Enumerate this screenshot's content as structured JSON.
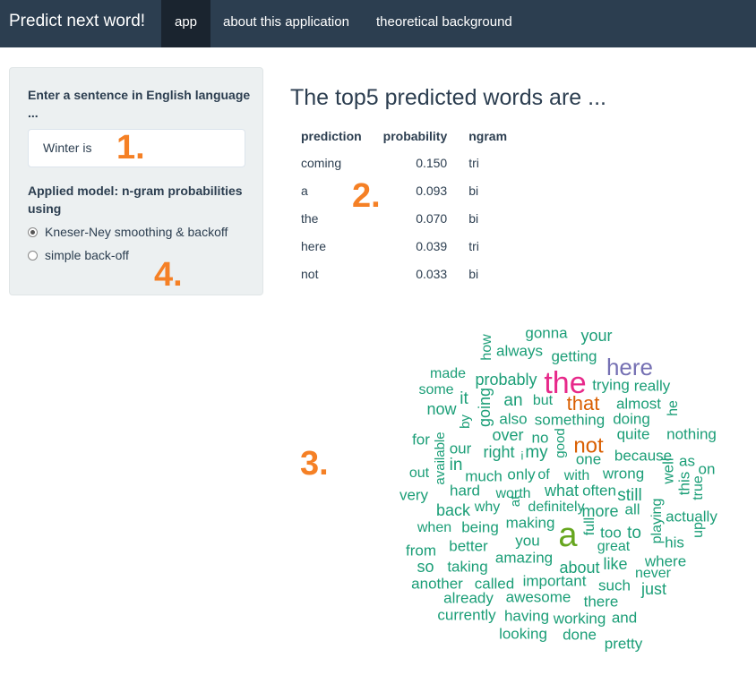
{
  "navbar": {
    "brand": "Predict next word!",
    "tabs": [
      "app",
      "about this application",
      "theoretical background"
    ]
  },
  "sidebar": {
    "input_label": "Enter a sentence in English language ...",
    "input_value": "Winter is",
    "model_label": "Applied model: n-gram probabilities using",
    "options": [
      {
        "label": "Kneser-Ney smoothing & backoff",
        "checked": true
      },
      {
        "label": "simple back-off",
        "checked": false
      }
    ]
  },
  "main": {
    "title": "The top5 predicted words are ...",
    "columns": [
      "prediction",
      "probability",
      "ngram"
    ],
    "rows": [
      [
        "coming",
        "0.150",
        "tri"
      ],
      [
        "a",
        "0.093",
        "bi"
      ],
      [
        "the",
        "0.070",
        "bi"
      ],
      [
        "here",
        "0.039",
        "tri"
      ],
      [
        "not",
        "0.033",
        "bi"
      ]
    ]
  },
  "markers": [
    "1.",
    "2.",
    "3.",
    "4."
  ],
  "colors": {
    "navbar": "#2c3e50",
    "active_tab": "#1a242f",
    "marker": "#f58025",
    "cloud_teal": "#1b9e77",
    "cloud_pink": "#e7298a",
    "cloud_purple": "#7570b3",
    "cloud_orange": "#d95f02",
    "cloud_green": "#66a61e"
  },
  "wordcloud": {
    "words": [
      "gonna",
      "your",
      "how",
      "always",
      "getting",
      "made",
      "the",
      "here",
      "some",
      "probably",
      "trying",
      "really",
      "it",
      "an",
      "but",
      "that",
      "almost",
      "now",
      "going",
      "he",
      "by",
      "also",
      "something",
      "doing",
      "for",
      "over",
      "no",
      "quite",
      "nothing",
      "available",
      "our",
      "right",
      "my",
      "not",
      "good",
      "because",
      "as",
      "in",
      "i",
      "one",
      "out",
      "much",
      "only",
      "of",
      "with",
      "wrong",
      "well",
      "on",
      "very",
      "hard",
      "what",
      "often",
      "this",
      "still",
      "back",
      "worth",
      "definitely",
      "true",
      "why",
      "at",
      "more",
      "all",
      "when",
      "being",
      "making",
      "actually",
      "full",
      "a",
      "playing",
      "from",
      "better",
      "you",
      "too",
      "to",
      "up",
      "so",
      "taking",
      "amazing",
      "great",
      "his",
      "about",
      "like",
      "where",
      "another",
      "called",
      "important",
      "such",
      "never",
      "already",
      "awesome",
      "there",
      "just",
      "currently",
      "having",
      "working",
      "and",
      "looking",
      "done",
      "pretty"
    ]
  }
}
